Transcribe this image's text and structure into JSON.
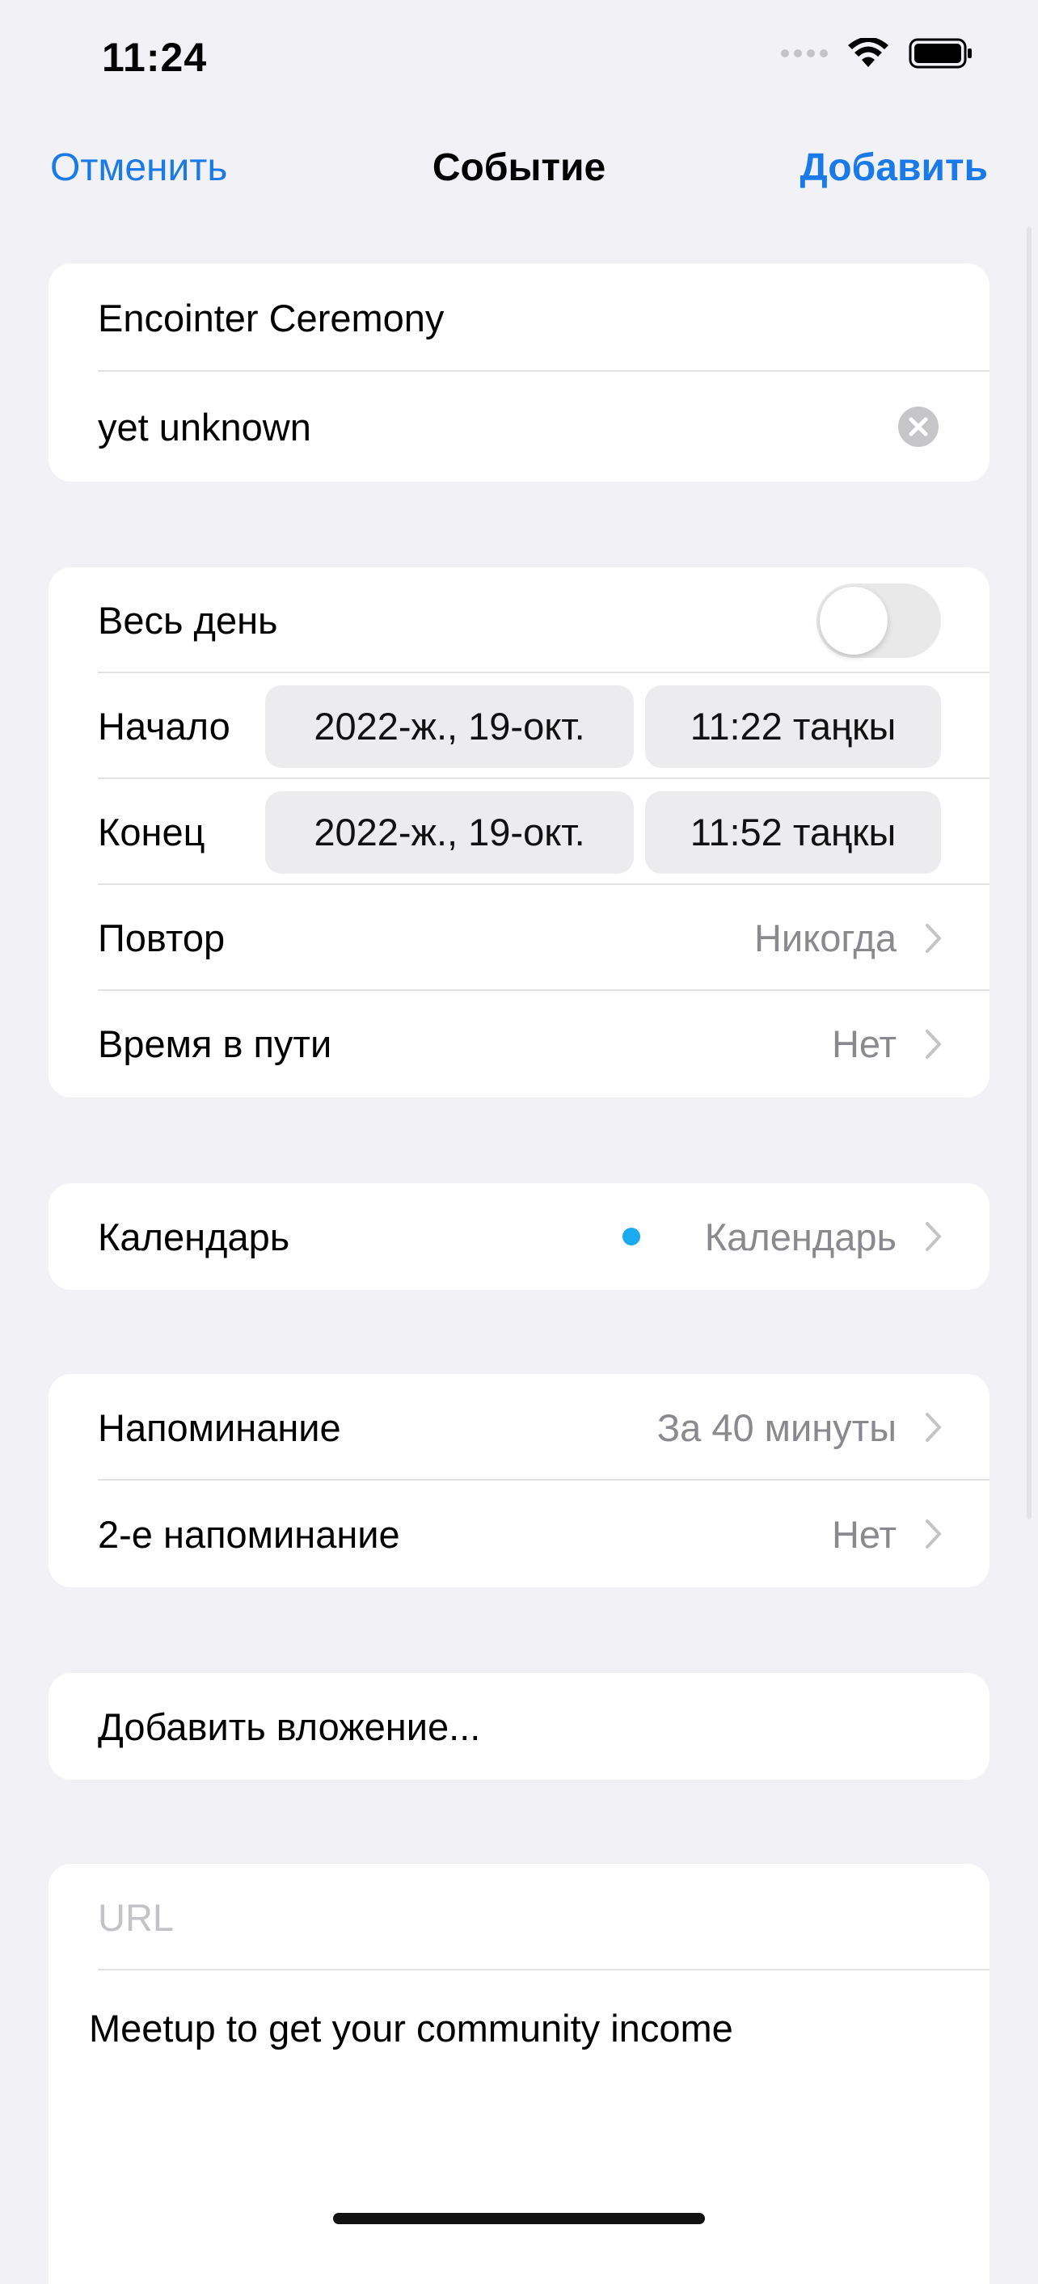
{
  "status_bar": {
    "time": "11:24"
  },
  "nav": {
    "cancel": "Отменить",
    "title": "Событие",
    "add": "Добавить"
  },
  "event": {
    "title": "Encointer Ceremony",
    "location": "yet unknown"
  },
  "timing": {
    "all_day_label": "Весь день",
    "all_day_on": false,
    "start_label": "Начало",
    "start_date": "2022-ж., 19-окт.",
    "start_time": "11:22 таңкы",
    "end_label": "Конец",
    "end_date": "2022-ж., 19-окт.",
    "end_time": "11:52 таңкы",
    "repeat_label": "Повтор",
    "repeat_value": "Никогда",
    "travel_label": "Время в пути",
    "travel_value": "Нет"
  },
  "calendar": {
    "label": "Календарь",
    "value": "Календарь",
    "dot_color": "#1aaaf0"
  },
  "alerts": {
    "alert_label": "Напоминание",
    "alert_value": "За 40 минуты",
    "second_label": "2-е напоминание",
    "second_value": "Нет"
  },
  "attachment": {
    "label": "Добавить вложение..."
  },
  "notes": {
    "url_placeholder": "URL",
    "text": "Meetup to get your community income"
  },
  "colors": {
    "accent": "#1a7be8",
    "background": "#f2f1f6"
  }
}
